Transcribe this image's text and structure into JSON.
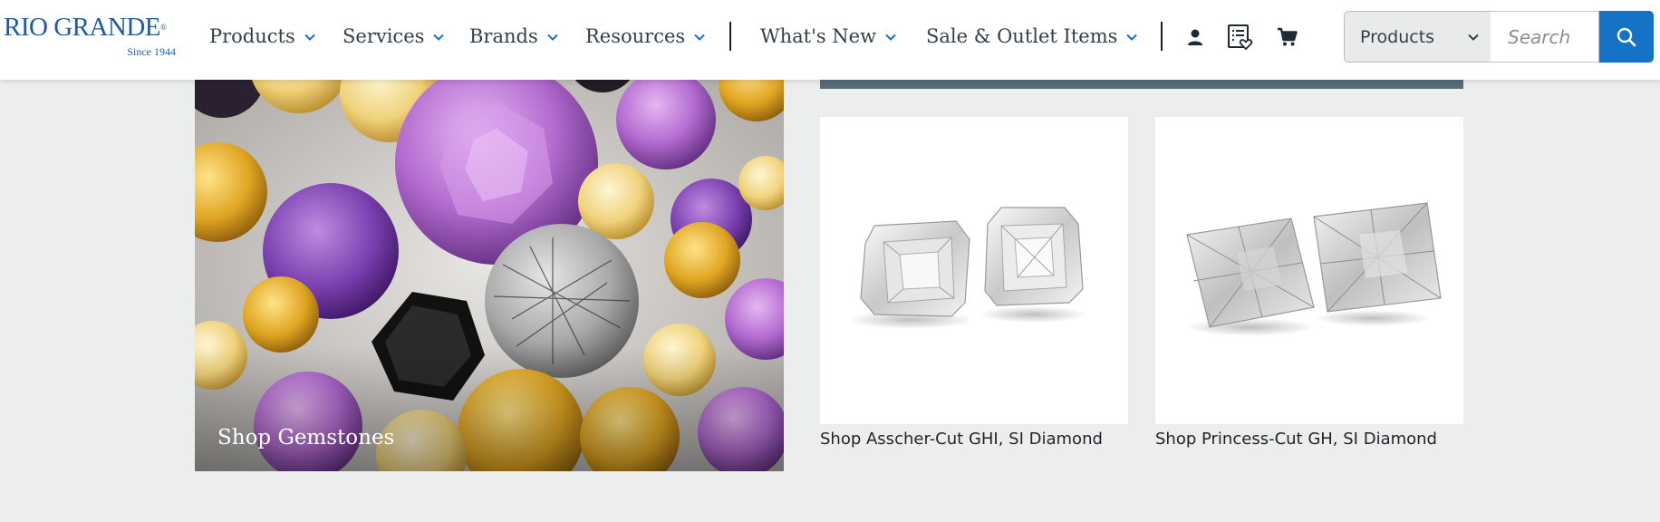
{
  "brand": {
    "name": "RIO GRANDE",
    "mark": "®",
    "tagline": "Since 1944"
  },
  "nav": {
    "items": [
      {
        "label": "Products"
      },
      {
        "label": "Services"
      },
      {
        "label": "Brands"
      },
      {
        "label": "Resources"
      },
      {
        "label": "What's New"
      },
      {
        "label": "Sale & Outlet Items"
      }
    ]
  },
  "icons": {
    "account": "user-icon",
    "list": "shopping-list-icon",
    "cart": "cart-icon"
  },
  "search": {
    "category": "Products",
    "placeholder": "Search"
  },
  "promo": {
    "gemstones_label": "Shop Gemstones",
    "cards": [
      {
        "label": "Shop Asscher-Cut GHI, SI Diamond"
      },
      {
        "label": "Shop Princess-Cut GH, SI Diamond"
      }
    ]
  },
  "colors": {
    "brand_blue": "#1d5aa6",
    "accent_blue": "#1473c6",
    "nav_text": "#333f48",
    "teal_bar": "#556d77",
    "page_bg": "#eceeee"
  }
}
